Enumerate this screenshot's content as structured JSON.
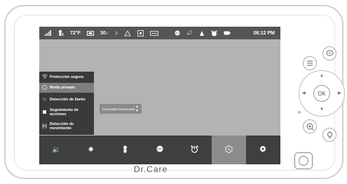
{
  "status_bar": {
    "signal_icon": "signal-bars-icon",
    "thermometer_icon": "baby-temperature-icon",
    "temperature": "72°F",
    "camera_icon": "camera-icon",
    "zoom": "30",
    "music_icon": "music-note-icon",
    "lullaby_icon": "lullaby-icon",
    "display_icon": "display-icon",
    "talk_icon": "walkie-talkie-icon",
    "chat_icon": "chat-icon",
    "volume_icon": "speaker-icon",
    "nightlight_icon": "night-light-icon",
    "alarm_icon": "alarm-icon",
    "battery_icon": "battery-icon",
    "time": "06:12 PM"
  },
  "menu": {
    "items": [
      {
        "label": "Protección segura",
        "icon": "wifi-icon",
        "selected": false
      },
      {
        "label": "Modo privado",
        "icon": "privacy-icon",
        "selected": true
      },
      {
        "label": "Detección de llanto",
        "icon": "crying-detection-icon",
        "selected": false
      },
      {
        "label": "Seguimiento de acciones",
        "icon": "action-tracking-icon",
        "selected": false
      },
      {
        "label": "Detección de movimiento",
        "icon": "motion-detection-icon",
        "selected": false
      }
    ]
  },
  "submenu": {
    "value": "Privacidad desactivada"
  },
  "toolbar": {
    "buttons": [
      {
        "icon": "volume-icon",
        "active": false
      },
      {
        "icon": "brightness-icon",
        "active": false
      },
      {
        "icon": "temperature-icon",
        "active": false
      },
      {
        "icon": "chat-icon",
        "active": false
      },
      {
        "icon": "alarm-clock-icon",
        "active": false
      },
      {
        "icon": "settings-tools-icon",
        "active": true
      },
      {
        "icon": "gear-icon",
        "active": false
      }
    ]
  },
  "brand": "Dr.Care",
  "controls": {
    "ok_label": "OK"
  }
}
